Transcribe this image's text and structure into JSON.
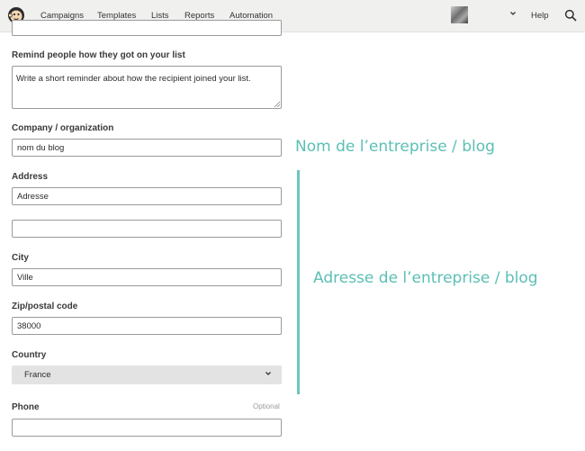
{
  "nav": {
    "items": [
      "Campaigns",
      "Templates",
      "Lists",
      "Reports",
      "Automation"
    ],
    "active": "Lists",
    "help": "Help"
  },
  "form": {
    "remind": {
      "label": "Remind people how they got on your list",
      "value": "Write a short reminder about how the recipient joined your list."
    },
    "company": {
      "label": "Company / organization",
      "value": "nom du blog"
    },
    "address": {
      "label": "Address",
      "line1": "Adresse",
      "line2": ""
    },
    "city": {
      "label": "City",
      "value": "Ville"
    },
    "zip": {
      "label": "Zip/postal code",
      "value": "38000"
    },
    "country": {
      "label": "Country",
      "value": "France"
    },
    "phone": {
      "label": "Phone",
      "optional": "Optional",
      "value": ""
    }
  },
  "annotations": {
    "company": "Nom de l’entreprise / blog",
    "address": "Adresse de l’entreprise / blog"
  },
  "colors": {
    "annotation": "#5bbfb5",
    "nav_bg": "#f0f0ef",
    "select_bg": "#e3e3e3"
  },
  "icons": [
    "mailchimp-logo-icon",
    "avatar",
    "chevron-down-icon",
    "search-icon",
    "resize-handle-icon"
  ]
}
